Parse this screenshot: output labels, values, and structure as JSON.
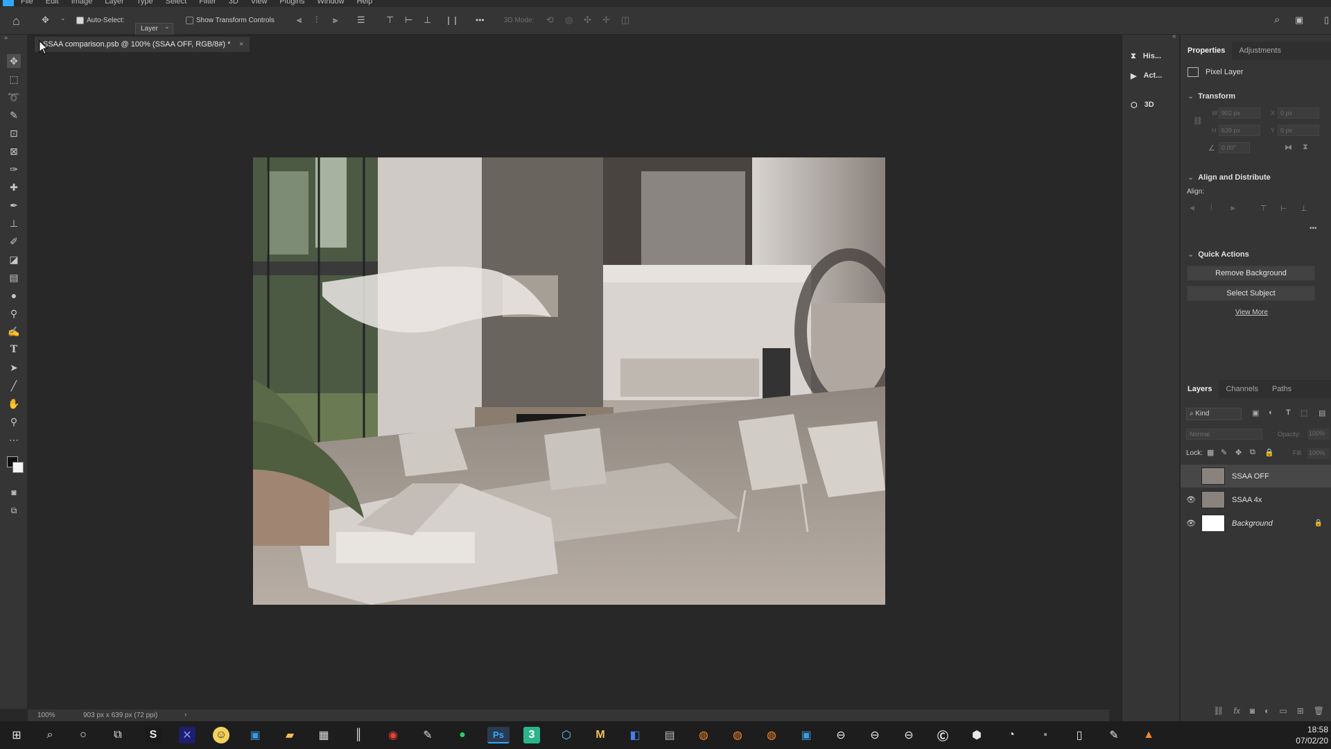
{
  "app": {
    "name": "Adobe Photoshop"
  },
  "menubar": {
    "items": [
      "File",
      "Edit",
      "Image",
      "Layer",
      "Type",
      "Select",
      "Filter",
      "3D",
      "View",
      "Plugins",
      "Window",
      "Help"
    ]
  },
  "options_bar": {
    "auto_select_label": "Auto-Select:",
    "auto_select_checked": true,
    "auto_select_target": "Layer",
    "show_transform_label": "Show Transform Controls",
    "show_transform_checked": false,
    "mode_3d_label": "3D Mode:",
    "more_label": "•••"
  },
  "document_tab": {
    "title": "SSAA comparison.psb @ 100% (SSAA OFF, RGB/8#) *",
    "close": "×"
  },
  "status_bar": {
    "zoom": "100%",
    "doc_info": "903 px x 639 px (72 ppi)",
    "arrow": "›"
  },
  "dock": {
    "items": [
      {
        "label": "His...",
        "icon": "history-icon"
      },
      {
        "label": "Act...",
        "icon": "actions-play-icon"
      },
      {
        "label": "3D",
        "icon": "cube-3d-icon"
      }
    ]
  },
  "properties_panel": {
    "tabs": [
      "Properties",
      "Adjustments"
    ],
    "active_tab": "Properties",
    "layer_type": "Pixel Layer",
    "transform": {
      "title": "Transform",
      "w_label": "W",
      "w_value": "902 px",
      "x_label": "X",
      "x_value": "0 px",
      "h_label": "H",
      "h_value": "639 px",
      "y_label": "Y",
      "y_value": "0 px",
      "angle_value": "0.00°"
    },
    "align": {
      "title": "Align and Distribute",
      "label": "Align:"
    },
    "quick_actions": {
      "title": "Quick Actions",
      "remove_background": "Remove Background",
      "select_subject": "Select Subject",
      "view_more": "View More"
    }
  },
  "layers_panel": {
    "tabs": [
      "Layers",
      "Channels",
      "Paths"
    ],
    "active_tab": "Layers",
    "filter_label": "Kind",
    "blend_mode": "Normal",
    "opacity_label": "Opacity:",
    "opacity_value": "100%",
    "lock_label": "Lock:",
    "fill_label": "Fill:",
    "fill_value": "100%",
    "layers": [
      {
        "name": "SSAA OFF",
        "visible": false,
        "selected": true,
        "locked": false
      },
      {
        "name": "SSAA 4x",
        "visible": true,
        "selected": false,
        "locked": false
      },
      {
        "name": "Background",
        "visible": true,
        "selected": false,
        "locked": true
      }
    ]
  },
  "taskbar": {
    "clock_time": "18:58",
    "clock_date": "07/02/20"
  },
  "colors": {
    "panel_bg": "#353535",
    "canvas_bg": "#282828",
    "accent_ps": "#31a8ff",
    "taskbar_bg": "#1d1d1d"
  }
}
